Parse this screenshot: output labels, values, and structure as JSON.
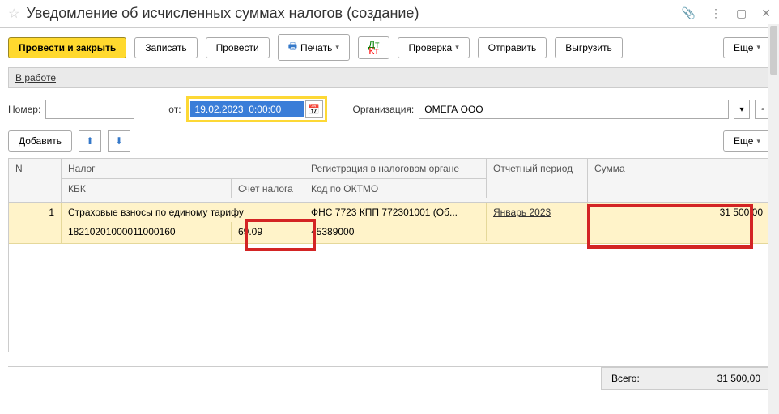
{
  "title": "Уведомление об исчисленных суммах налогов (создание)",
  "toolbar": {
    "submit_close": "Провести и закрыть",
    "save": "Записать",
    "submit": "Провести",
    "print": "Печать",
    "check": "Проверка",
    "send": "Отправить",
    "export": "Выгрузить",
    "more": "Еще"
  },
  "status": "В работе",
  "form": {
    "number_label": "Номер:",
    "from_label": "от:",
    "date_value": "19.02.2023  0:00:00",
    "org_label": "Организация:",
    "org_value": "ОМЕГА ООО"
  },
  "toolbar2": {
    "add": "Добавить",
    "more": "Еще"
  },
  "table": {
    "headers": {
      "n": "N",
      "tax": "Налог",
      "kbk": "КБК",
      "acc": "Счет налога",
      "reg": "Регистрация в налоговом органе",
      "oktmo": "Код по ОКТМО",
      "period": "Отчетный период",
      "sum": "Сумма"
    },
    "rows": [
      {
        "n": "1",
        "tax": "Страховые взносы по единому тарифу",
        "kbk": "18210201000011000160",
        "acc": "69.09",
        "reg": "ФНС 7723 КПП 772301001 (Об...",
        "oktmo": "45389000",
        "period": "Январь 2023",
        "sum": "31 500,00"
      }
    ]
  },
  "footer": {
    "total_label": "Всего:",
    "total_value": "31 500,00"
  }
}
